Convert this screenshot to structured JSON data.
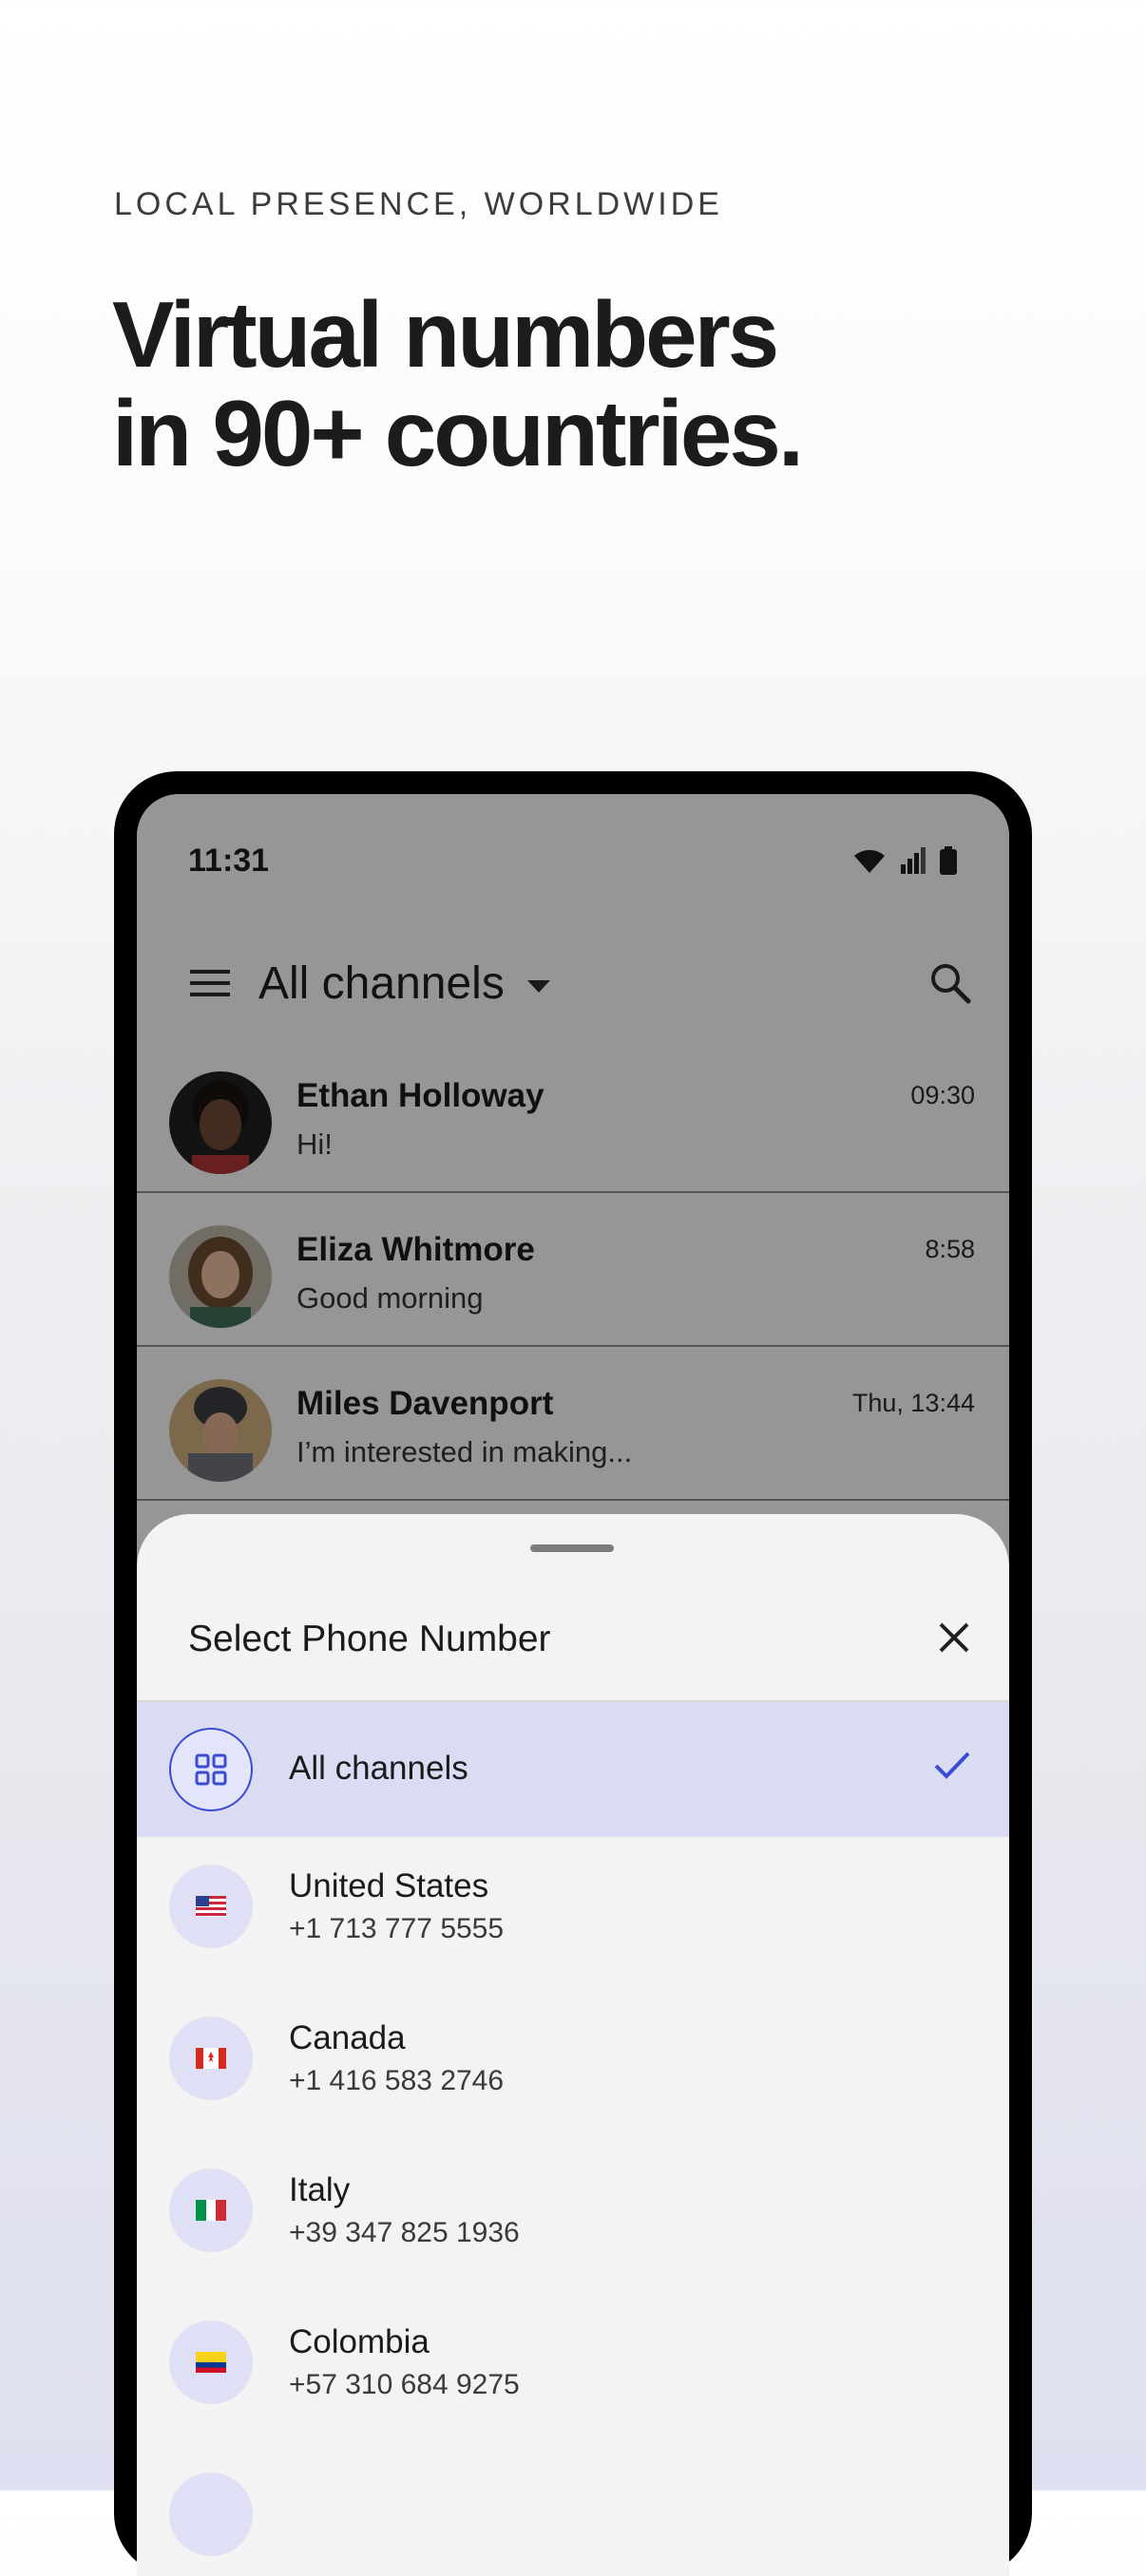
{
  "promo": {
    "tagline": "LOCAL PRESENCE, WORLDWIDE",
    "headline_line1": "Virtual numbers",
    "headline_line2": "in 90+ countries."
  },
  "status_bar": {
    "time": "11:31",
    "icons": [
      "wifi-icon",
      "signal-icon",
      "battery-icon"
    ]
  },
  "header": {
    "menu_icon": "hamburger-menu-icon",
    "title": "All channels",
    "dropdown_icon": "caret-down-icon",
    "search_icon": "search-icon"
  },
  "conversations": [
    {
      "name": "Ethan Holloway",
      "preview": "Hi!",
      "time": "09:30",
      "avatar_color": "#3a2a22"
    },
    {
      "name": "Eliza Whitmore",
      "preview": "Good morning",
      "time": "8:58",
      "avatar_color": "#8a6a50"
    },
    {
      "name": "Miles Davenport",
      "preview": "I’m interested in making...",
      "time": "Thu, 13:44",
      "avatar_color": "#5b5f66"
    }
  ],
  "sheet": {
    "title": "Select Phone Number",
    "close_icon": "close-icon",
    "options": [
      {
        "label": "All channels",
        "number": "",
        "icon": "grid-icon",
        "selected": true
      },
      {
        "label": "United States",
        "number": "+1 713 777 5555",
        "icon": "us-flag-icon",
        "selected": false
      },
      {
        "label": "Canada",
        "number": "+1 416 583 2746",
        "icon": "canada-flag-icon",
        "selected": false
      },
      {
        "label": "Italy",
        "number": "+39 347 825 1936",
        "icon": "italy-flag-icon",
        "selected": false
      },
      {
        "label": "Colombia",
        "number": "+57 310 684 9275",
        "icon": "colombia-flag-icon",
        "selected": false
      }
    ]
  },
  "colors": {
    "accent": "#3b4bd4",
    "selected_row": "#d9dcf3",
    "icon_circle": "#dfe0f5"
  }
}
